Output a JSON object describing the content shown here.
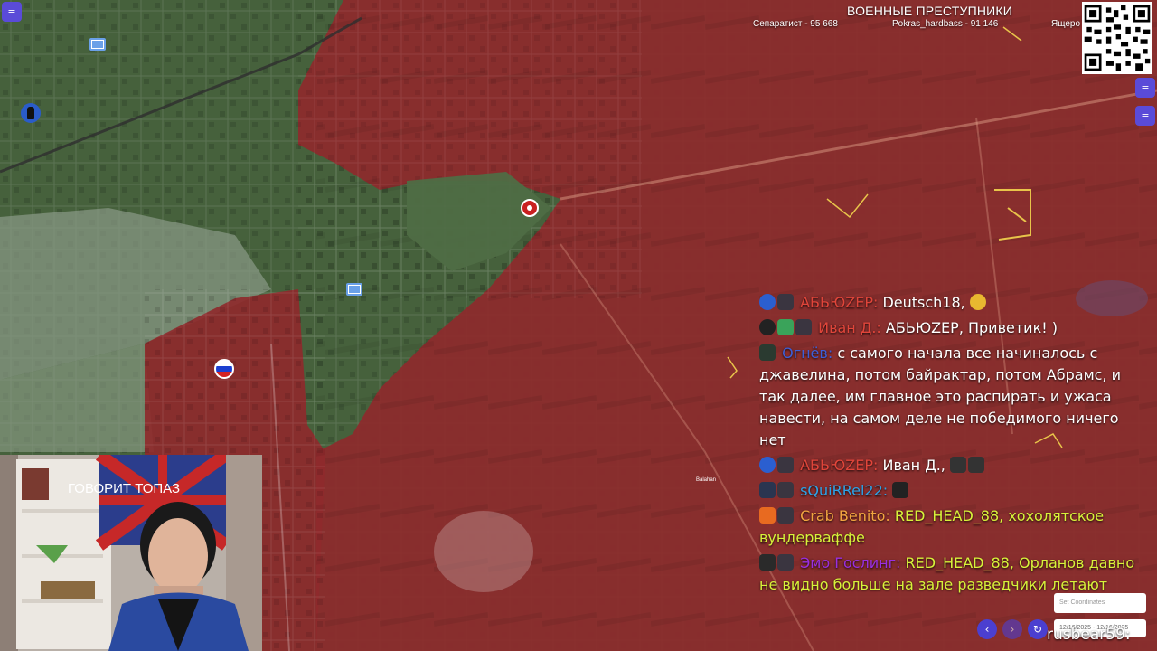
{
  "header": {
    "title": "ВОЕННЫЕ ПРЕСТУПНИКИ",
    "stats": [
      {
        "label": "Сепаратист - 95 668"
      },
      {
        "label": "Pokras_hardbass - 91 146"
      },
      {
        "label": "Ящеро"
      }
    ]
  },
  "map": {
    "colors": {
      "occupied": "#8e2a2d",
      "contested_green": "#46613c",
      "urban_light": "#7a8a72"
    },
    "place_label": "Balahan"
  },
  "webcam": {
    "sign_text": "ГОВОРИТ ТОПАЗ"
  },
  "chat": {
    "messages": [
      {
        "user": "АБЬЮZЕР:",
        "user_color": "#e0453a",
        "text": "Deutsch18,",
        "badges": [
          "blue-circle-icon",
          "avatar-icon"
        ],
        "emote": "handshake-icon"
      },
      {
        "user": "Иван Д.:",
        "user_color": "#e0453a",
        "text": "АБЬЮZЕР, Приветик! )",
        "badges": [
          "avatar-icon",
          "shield-icon",
          "avatar-icon"
        ]
      },
      {
        "user": "Огнёв:",
        "user_color": "#3d5fd8",
        "text": "с самого начала все начиналось с джавелина, потом байрактар, потом Абрамс, и так далее, им главное это распирать и ужаса навести, на самом деле не победимого ничего нет",
        "badges": [
          "avatar-icon"
        ]
      },
      {
        "user": "АБЬЮZЕР:",
        "user_color": "#e0453a",
        "text": "Иван Д.,",
        "badges": [
          "blue-circle-icon",
          "avatar-icon"
        ],
        "emote": "emote-icon"
      },
      {
        "user": "sQuiRRel22:",
        "user_color": "#2ea3e8",
        "text": "",
        "badges": [
          "avatar-icon",
          "avatar-icon"
        ],
        "emote": "emote-icon"
      },
      {
        "user": "Crab Benito:",
        "user_color": "#f2a540",
        "text": "RED_HEAD_88, хохолятское вундерваффе",
        "text_color": "#d8f23a",
        "badges": [
          "flame-icon",
          "avatar-icon"
        ]
      },
      {
        "user": "Эмо Гослинг:",
        "user_color": "#9a2fe0",
        "text": "RED_HEAD_88,  Орланов давно не видно больше на зале разведчики летают",
        "text_color": "#d8f23a",
        "badges": [
          "avatar-icon",
          "avatar-icon"
        ]
      }
    ]
  },
  "controls": {
    "coords_placeholder": "Set Coordinates",
    "date_range": "12/16/2025 - 12/16/2025",
    "prev_icon": "‹",
    "next_icon": "›",
    "refresh_icon": "↻"
  },
  "watermark": "rusbear59:"
}
